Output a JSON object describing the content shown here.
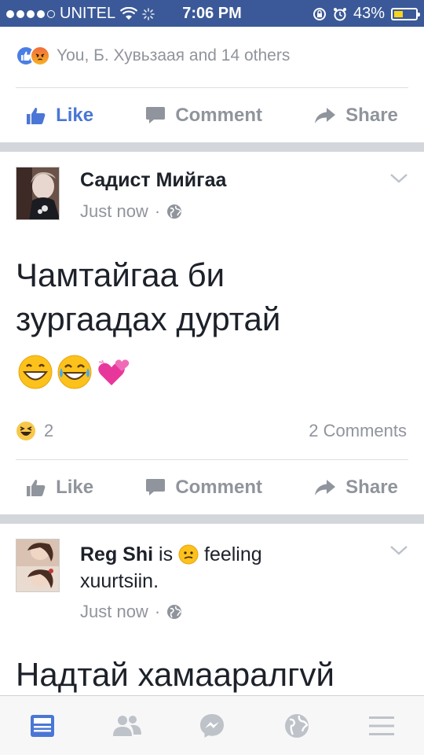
{
  "status_bar": {
    "carrier": "UNITEL",
    "time": "7:06 PM",
    "battery": "43%",
    "battery_level": 0.43
  },
  "top_post": {
    "reaction_summary": "You, Б. Хувьзаая and 14 others",
    "actions": {
      "like": "Like",
      "comment": "Comment",
      "share": "Share"
    },
    "liked": true
  },
  "post1": {
    "author": "Садист Мийгаа",
    "timestamp": "Just now",
    "dot": "·",
    "text_line1": "Чамтайгаа би",
    "text_line2": "зургаадах дуртай",
    "emojis": [
      "grinning-face-icon",
      "tears-of-joy-icon",
      "two-hearts-icon"
    ],
    "reaction_count": "2",
    "comment_count": "2 Comments",
    "actions": {
      "like": "Like",
      "comment": "Comment",
      "share": "Share"
    }
  },
  "post2": {
    "author": "Reg Shi",
    "is": "is",
    "feeling": "feeling",
    "feeling_value": "xuurtsiin.",
    "timestamp": "Just now",
    "dot": "·",
    "text_line1": "Надтай хамааралгvй"
  },
  "tabbar": [
    "news-feed-icon",
    "friends-icon",
    "messenger-icon",
    "globe-icon",
    "menu-icon"
  ],
  "colors": {
    "brand": "#3b5998",
    "like": "#4a76d6",
    "muted": "#90949c"
  }
}
